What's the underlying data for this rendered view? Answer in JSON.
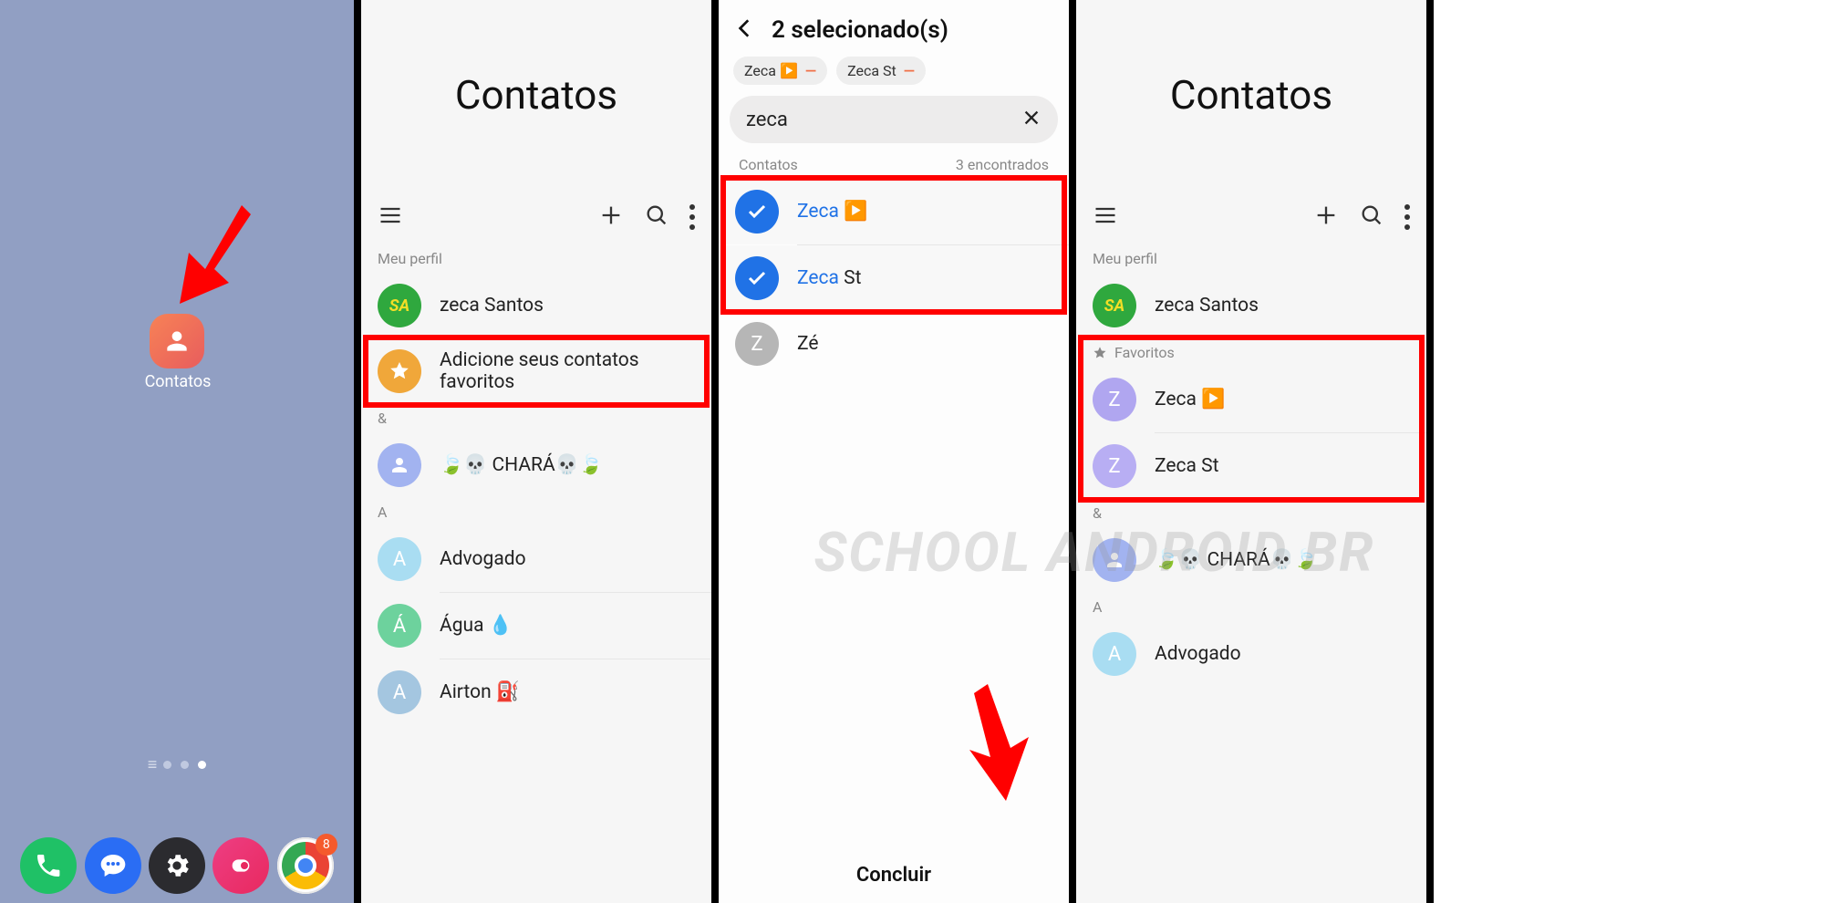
{
  "panel1": {
    "app_label": "Contatos",
    "chrome_badge": "8"
  },
  "panel2": {
    "title": "Contatos",
    "profile_label": "Meu perfil",
    "profile_name": "zeca Santos",
    "favorites_prompt": "Adicione seus contatos favoritos",
    "group_amp": "&",
    "contact_chara": "🍃💀 CHARÁ💀🍃",
    "group_a": "A",
    "contact_advogado": "Advogado",
    "contact_agua": "Água 💧",
    "contact_airton": "Airton ⛽"
  },
  "panel3": {
    "selected_title": "2 selecionado(s)",
    "chip1": "Zeca ▶️",
    "chip2": "Zeca St",
    "search_query": "zeca",
    "results_label": "Contatos",
    "results_count": "3 encontrados",
    "r1_match": "Zeca",
    "r1_tail": " ▶️",
    "r2_match": "Zeca",
    "r2_tail": " St",
    "r3_name": "Zé",
    "concluir": "Concluir"
  },
  "panel4": {
    "title": "Contatos",
    "profile_label": "Meu perfil",
    "profile_name": "zeca Santos",
    "favorites_label": "Favoritos",
    "fav1": "Zeca ▶️",
    "fav2": "Zeca St",
    "group_amp": "&",
    "contact_chara": "🍃💀 CHARÁ💀🍃",
    "group_a": "A",
    "contact_advogado": "Advogado"
  },
  "watermark": "SCHOOL ANDROID BR"
}
